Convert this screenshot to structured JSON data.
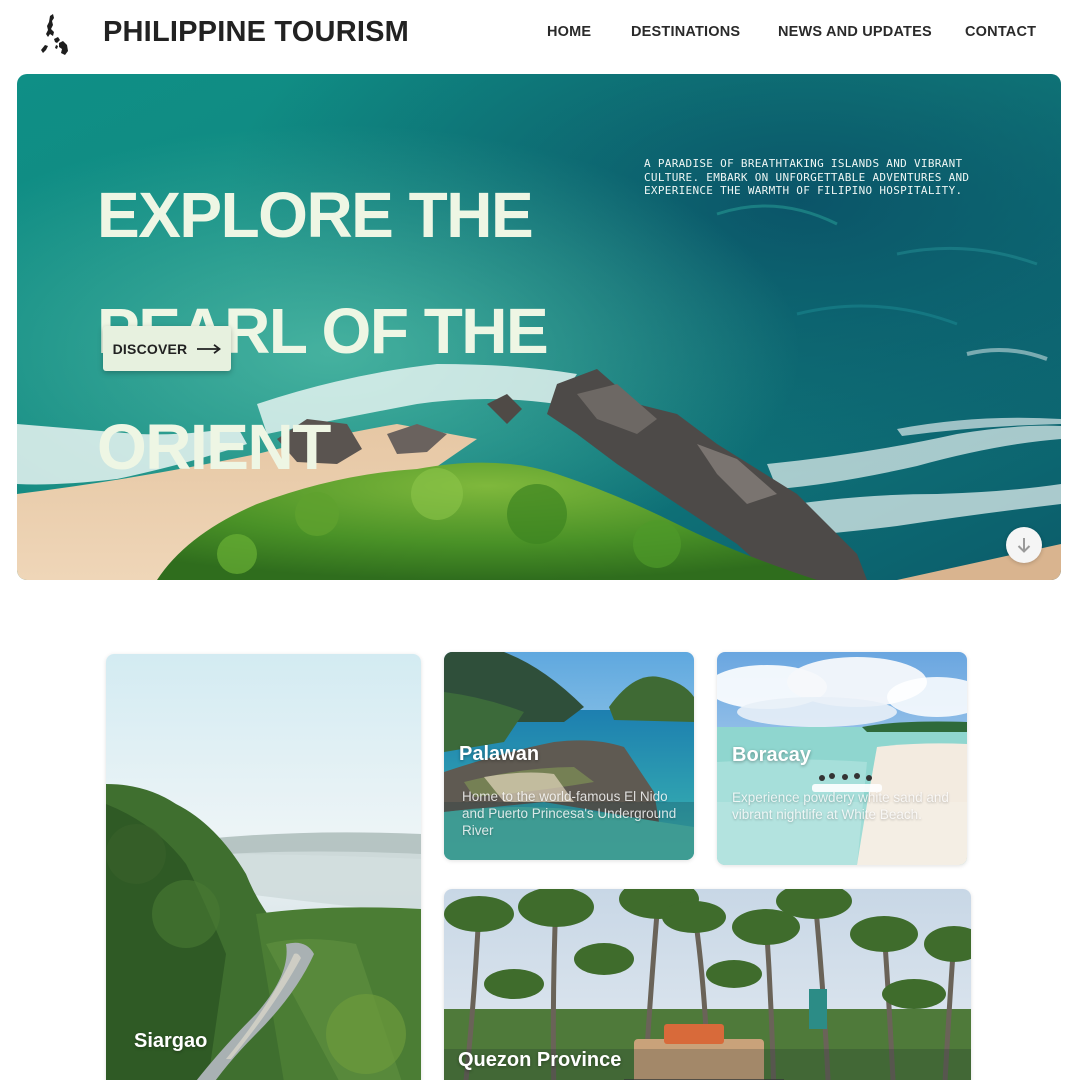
{
  "header": {
    "brand": "PHILIPPINE TOURISM",
    "logo_icon": "philippines-map-icon",
    "nav": [
      {
        "label": "HOME"
      },
      {
        "label": "DESTINATIONS"
      },
      {
        "label": "NEWS AND UPDATES"
      },
      {
        "label": "CONTACT"
      }
    ]
  },
  "hero": {
    "title_lines": [
      "EXPLORE THE",
      "PEARL OF THE",
      "ORIENT"
    ],
    "description": "A PARADISE OF BREATHTAKING ISLANDS AND VIBRANT CULTURE. EMBARK ON UNFORGETTABLE ADVENTURES AND EXPERIENCE THE WARMTH OF FILIPINO HOSPITALITY.",
    "cta_label": "DISCOVER",
    "cta_icon": "arrow-right-icon",
    "scroll_icon": "arrow-down-icon"
  },
  "destinations": [
    {
      "name": "Siargao",
      "description": ""
    },
    {
      "name": "Palawan",
      "description": "Home to the world-famous El Nido and Puerto Princesa's Underground River"
    },
    {
      "name": "Boracay",
      "description": "Experience powdery white sand and vibrant nightlife at White Beach."
    },
    {
      "name": "Quezon Province",
      "description": ""
    }
  ],
  "colors": {
    "hero_title": "#eef6e4",
    "button_bg": "#e7f1df",
    "text_dark": "#222222"
  }
}
